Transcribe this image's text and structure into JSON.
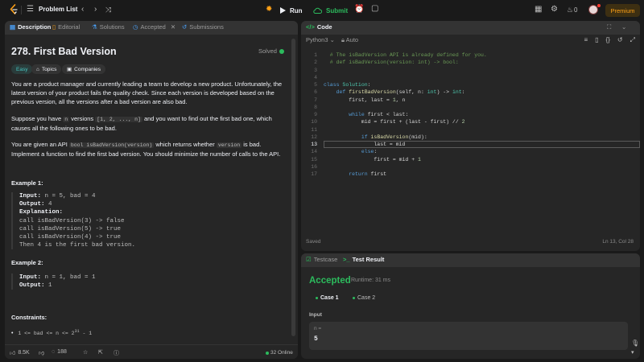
{
  "topbar": {
    "problem_list_label": "Problem List",
    "run_label": "Run",
    "submit_label": "Submit",
    "streak_count": "0",
    "premium_label": "Premium"
  },
  "left_tabs": [
    {
      "label": "Description"
    },
    {
      "label": "Editorial"
    },
    {
      "label": "Solutions"
    },
    {
      "label": "Accepted"
    },
    {
      "label": "Submissions"
    }
  ],
  "problem": {
    "title": "278. First Bad Version",
    "status": "Solved",
    "difficulty": "Easy",
    "topics_label": "Topics",
    "companies_label": "Companies",
    "p1": "You are a product manager and currently leading a team to develop a new product. Unfortunately, the latest version of your product fails the quality check. Since each version is developed based on the previous version, all the versions after a bad version are also bad.",
    "p2_a": "Suppose you have",
    "p2_n": "n",
    "p2_b": "versions",
    "p2_list": "[1, 2, ..., n]",
    "p2_c": "and you want to find out the first bad one, which causes all the following ones to be bad.",
    "p3_a": "You are given an API",
    "p3_api": "bool isBadVersion(version)",
    "p3_b": "which returns whether",
    "p3_version": "version",
    "p3_c": "is bad. Implement a function to find the first bad version. You should minimize the number of calls to the API.",
    "example1_title": "Example 1:",
    "example1_input_label": "Input:",
    "example1_input": " n = 5, bad = 4",
    "example1_output_label": "Output:",
    "example1_output": " 4",
    "example1_expl_label": "Explanation:",
    "example1_expl": "call isBadVersion(3) -> false\ncall isBadVersion(5) -> true\ncall isBadVersion(4) -> true\nThen 4 is the first bad version.",
    "example2_title": "Example 2:",
    "example2_input_label": "Input:",
    "example2_input": " n = 1, bad = 1",
    "example2_output_label": "Output:",
    "example2_output": " 1",
    "constraints_title": "Constraints:",
    "constraint1_a": "1 <= bad <= n <= 2",
    "constraint1_exp": "31",
    "constraint1_b": " - 1"
  },
  "left_bottom": {
    "likes": "8.5K",
    "comments": "188",
    "online": "32 Online"
  },
  "code_panel": {
    "title": "Code",
    "language": "Python3",
    "auto_label": "Auto",
    "saved_label": "Saved",
    "cursor_pos": "Ln 13, Col 28",
    "current_line": 13
  },
  "code_lines": [
    {
      "n": "1",
      "html": "<span class='cm'>  # The isBadVersion API is already defined for you.</span>"
    },
    {
      "n": "2",
      "html": "<span class='cm'>  # def isBadVersion(version: int) -> bool:</span>"
    },
    {
      "n": "3",
      "html": ""
    },
    {
      "n": "4",
      "html": ""
    },
    {
      "n": "5",
      "html": "<span class='kw'>class</span> <span class='cls'>Solution</span>:"
    },
    {
      "n": "6",
      "html": "    <span class='kw'>def</span> <span class='fn'>firstBadVersion</span>(self, n: <span class='cls'>int</span>) -> <span class='cls'>int</span>:"
    },
    {
      "n": "7",
      "html": "        first, last = <span class='nu'>1</span>, n"
    },
    {
      "n": "8",
      "html": ""
    },
    {
      "n": "9",
      "html": "        <span class='kw'>while</span> first &lt; last:"
    },
    {
      "n": "10",
      "html": "            mid = first + (last - first) // <span class='nu'>2</span>"
    },
    {
      "n": "11",
      "html": ""
    },
    {
      "n": "12",
      "html": "            <span class='kw'>if</span> <span class='fn'>isBadVersion</span>(mid):"
    },
    {
      "n": "13",
      "html": "                last = mid"
    },
    {
      "n": "14",
      "html": "            <span class='kw'>else</span>:"
    },
    {
      "n": "15",
      "html": "                first = mid + <span class='nu'>1</span>"
    },
    {
      "n": "16",
      "html": ""
    },
    {
      "n": "17",
      "html": "        <span class='kw'>return</span> first"
    }
  ],
  "test_panel": {
    "tab_testcase": "Testcase",
    "tab_result": "Test Result",
    "status": "Accepted",
    "runtime": "Runtime: 31 ms",
    "case1": "Case 1",
    "case2": "Case 2",
    "input_label": "Input",
    "input_key": "n =",
    "input_value": "5"
  },
  "colors": {
    "accent_orange": "#ffa116",
    "accent_green": "#2cbb5d",
    "accent_blue": "#4a9ff5",
    "panel_bg": "#262626",
    "app_bg": "#1a1a1a"
  }
}
